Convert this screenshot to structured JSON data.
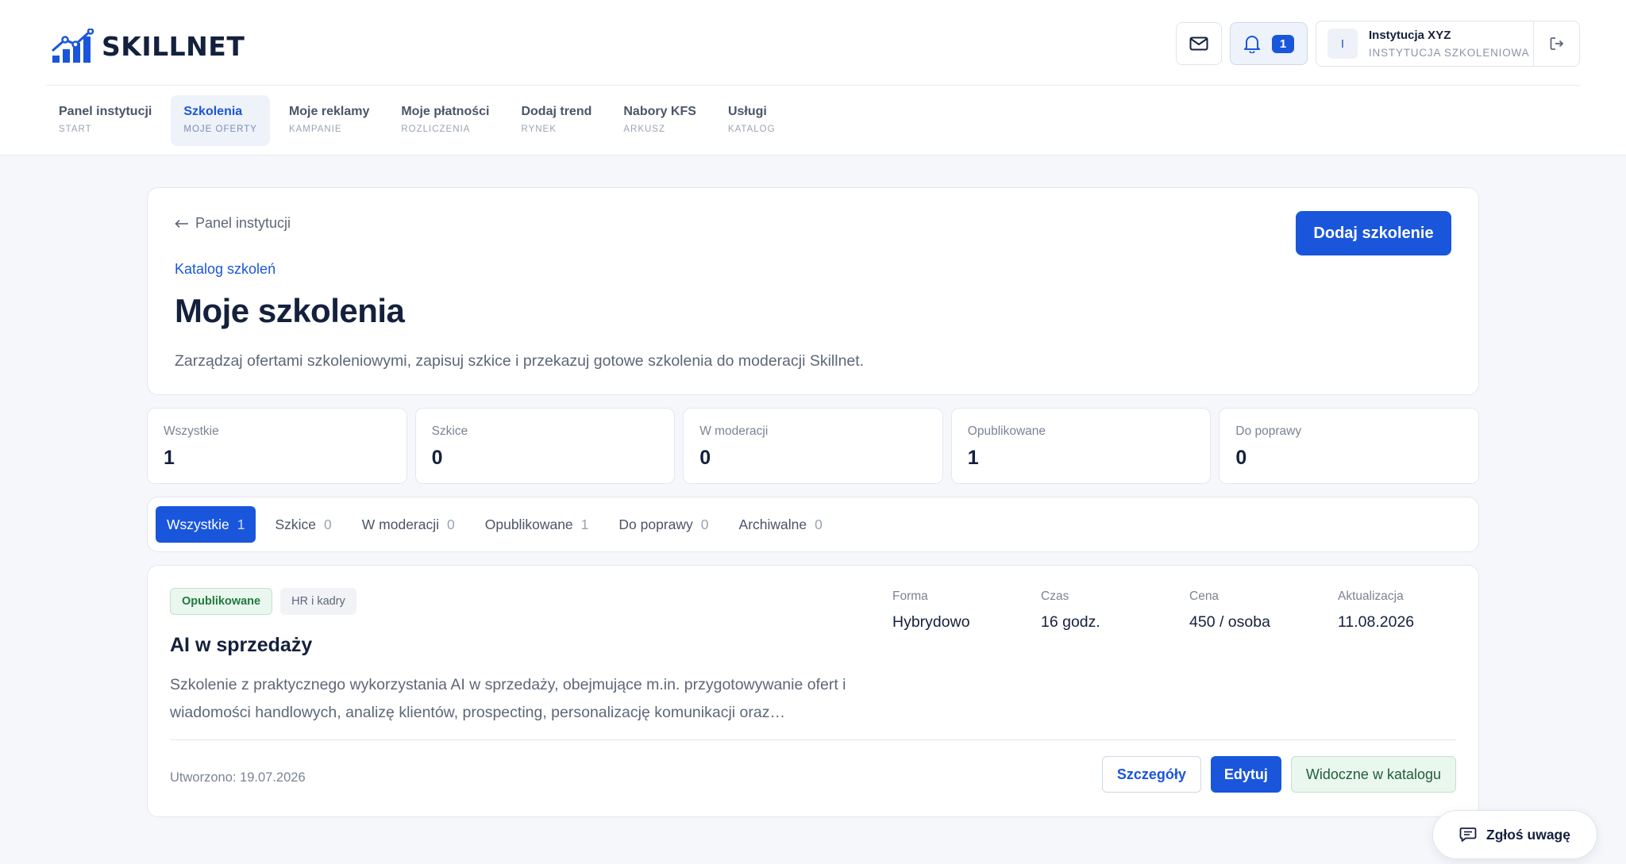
{
  "brand": {
    "name": "SKILLNET",
    "accent": "#1a56db"
  },
  "header": {
    "notifications_count": "1",
    "user": {
      "initial": "I",
      "name": "Instytucja XYZ",
      "role": "INSTYTUCJA SZKOLENIOWA"
    }
  },
  "nav": [
    {
      "label": "Panel instytucji",
      "sub": "START"
    },
    {
      "label": "Szkolenia",
      "sub": "MOJE OFERTY"
    },
    {
      "label": "Moje reklamy",
      "sub": "KAMPANIE"
    },
    {
      "label": "Moje płatności",
      "sub": "ROZLICZENIA"
    },
    {
      "label": "Dodaj trend",
      "sub": "RYNEK"
    },
    {
      "label": "Nabory KFS",
      "sub": "ARKUSZ"
    },
    {
      "label": "Usługi",
      "sub": "KATALOG"
    }
  ],
  "hero": {
    "back_label": "Panel instytucji",
    "crumb": "Katalog szkoleń",
    "title": "Moje szkolenia",
    "description": "Zarządzaj ofertami szkoleniowymi, zapisuj szkice i przekazuj gotowe szkolenia do moderacji Skillnet.",
    "add_button": "Dodaj szkolenie"
  },
  "stats": [
    {
      "label": "Wszystkie",
      "value": "1"
    },
    {
      "label": "Szkice",
      "value": "0"
    },
    {
      "label": "W moderacji",
      "value": "0"
    },
    {
      "label": "Opublikowane",
      "value": "1"
    },
    {
      "label": "Do poprawy",
      "value": "0"
    }
  ],
  "filters": [
    {
      "label": "Wszystkie",
      "count": "1"
    },
    {
      "label": "Szkice",
      "count": "0"
    },
    {
      "label": "W moderacji",
      "count": "0"
    },
    {
      "label": "Opublikowane",
      "count": "1"
    },
    {
      "label": "Do poprawy",
      "count": "0"
    },
    {
      "label": "Archiwalne",
      "count": "0"
    }
  ],
  "course": {
    "status": "Opublikowane",
    "category": "HR i kadry",
    "title": "AI w sprzedaży",
    "description": "Szkolenie z praktycznego wykorzystania AI w sprzedaży, obejmujące m.in. przygotowywanie ofert i wiadomości handlowych, analizę klientów, prospecting, personalizację komunikacji oraz…",
    "meta": [
      {
        "label": "Forma",
        "value": "Hybrydowo"
      },
      {
        "label": "Czas",
        "value": "16 godz."
      },
      {
        "label": "Cena",
        "value": "450 / osoba"
      },
      {
        "label": "Aktualizacja",
        "value": "11.08.2026"
      }
    ],
    "created": "Utworzono: 19.07.2026",
    "details_button": "Szczegóły",
    "edit_button": "Edytuj",
    "visible_button": "Widoczne w katalogu"
  },
  "report_button": "Zgłoś uwagę",
  "icons": {
    "logo": "bar-chart-logo-icon",
    "mail": "mail-icon",
    "bell": "bell-icon",
    "logout": "logout-icon",
    "back": "arrow-left-icon",
    "report": "chat-icon"
  }
}
